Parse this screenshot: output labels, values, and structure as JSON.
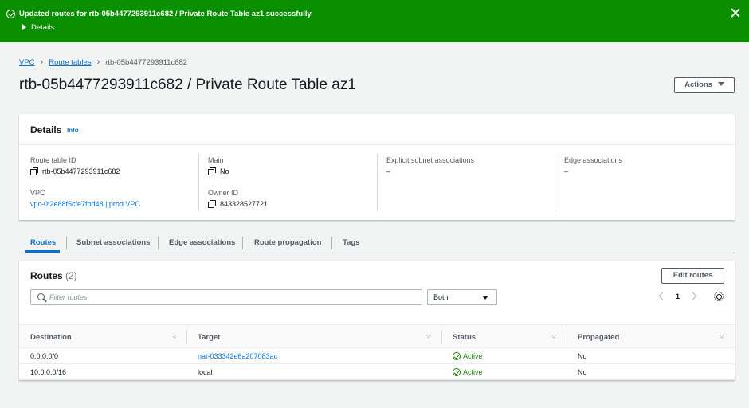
{
  "flash": {
    "message": "Updated routes for rtb-05b4477293911c682 / Private Route Table az1 successfully",
    "details_label": "Details",
    "color": "#0a8f00"
  },
  "breadcrumb": {
    "items": [
      "VPC",
      "Route tables"
    ],
    "current": "rtb-05b4477293911c682"
  },
  "page_title": "rtb-05b4477293911c682 / Private Route Table az1",
  "actions_label": "Actions",
  "details": {
    "title": "Details",
    "info": "Info",
    "route_table_id_label": "Route table ID",
    "route_table_id": "rtb-05b4477293911c682",
    "vpc_label": "VPC",
    "vpc_value": "vpc-0f2e88f5cfe7fbd48 | prod VPC",
    "main_label": "Main",
    "main_value": "No",
    "owner_label": "Owner ID",
    "owner_value": "843328527721",
    "explicit_label": "Explicit subnet associations",
    "explicit_value": "–",
    "edge_label": "Edge associations",
    "edge_value": "–"
  },
  "tabs": [
    "Routes",
    "Subnet associations",
    "Edge associations",
    "Route propagation",
    "Tags"
  ],
  "routes": {
    "title": "Routes",
    "count": "(2)",
    "edit_label": "Edit routes",
    "filter_placeholder": "Filter routes",
    "filter_select": "Both",
    "page": "1",
    "columns": [
      "Destination",
      "Target",
      "Status",
      "Propagated"
    ],
    "rows": [
      {
        "destination": "0.0.0.0/0",
        "target": "nat-033342e6a207083ac",
        "status": "Active",
        "propagated": "No"
      },
      {
        "destination": "10.0.0.0/16",
        "target": "local",
        "status": "Active",
        "propagated": "No"
      }
    ]
  },
  "colors": {
    "accent": "#0972d3",
    "success": "#1d8102"
  }
}
